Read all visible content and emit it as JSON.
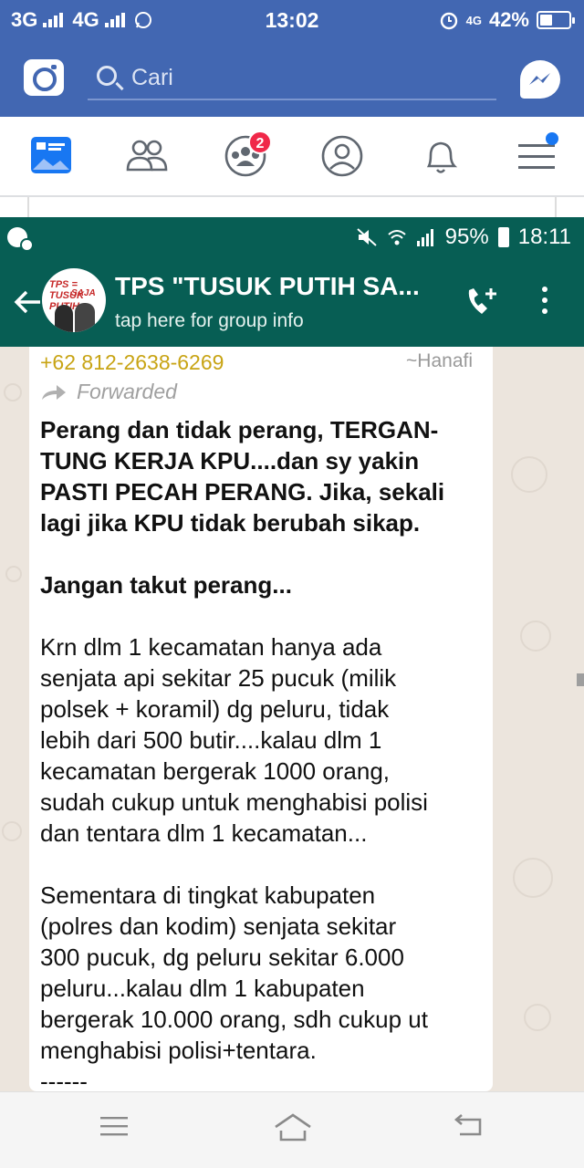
{
  "fb_status": {
    "net1": "3G",
    "net2": "4G",
    "time": "13:02",
    "lte": "4G",
    "battery": "42%",
    "battery_level": 0.42
  },
  "fb_bar": {
    "search_placeholder": "Cari",
    "icons": [
      "camera-icon",
      "search-icon",
      "messenger-icon"
    ]
  },
  "fb_nav": {
    "groups_badge": "2",
    "icons": [
      "feed-icon",
      "friends-icon",
      "groups-icon",
      "profile-icon",
      "bell-icon",
      "menu-icon"
    ]
  },
  "wa_status": {
    "battery": "95%",
    "time": "18:11"
  },
  "wa_header": {
    "title": "TPS \"TUSUK PUTIH SA...",
    "subtitle": "tap here for group info",
    "avatar_text_1": "TPS = TUSUK PUTIH",
    "avatar_text_2": "SAJA"
  },
  "message": {
    "sender": "+62 812-2638-6269",
    "author": "~Hanafi",
    "forwarded": "Forwarded",
    "bold_lines": [
      "Perang dan tidak perang, TERGAN-",
      "TUNG KERJA KPU....dan sy yakin",
      "PASTI PECAH PERANG. Jika, sekali",
      "lagi jika KPU tidak berubah sikap."
    ],
    "bold_para2": "Jangan takut perang...",
    "para3": [
      "Krn dlm 1 kecamatan hanya ada",
      "senjata api sekitar 25 pucuk (milik",
      "polsek + koramil) dg peluru, tidak",
      "lebih dari 500 butir....kalau dlm 1",
      "kecamatan bergerak 1000 orang,",
      "sudah cukup untuk menghabisi polisi",
      "dan tentara dlm 1 kecamatan..."
    ],
    "para4": [
      "Sementara di tingkat kabupaten",
      "(polres dan kodim) senjata sekitar",
      "300 pucuk, dg peluru sekitar 6.000",
      "peluru...kalau dlm 1 kabupaten",
      "bergerak 10.000 orang, sdh cukup ut",
      "menghabisi polisi+tentara."
    ],
    "separator": "------"
  },
  "system_nav": [
    "menu-icon",
    "home-icon",
    "back-icon"
  ]
}
